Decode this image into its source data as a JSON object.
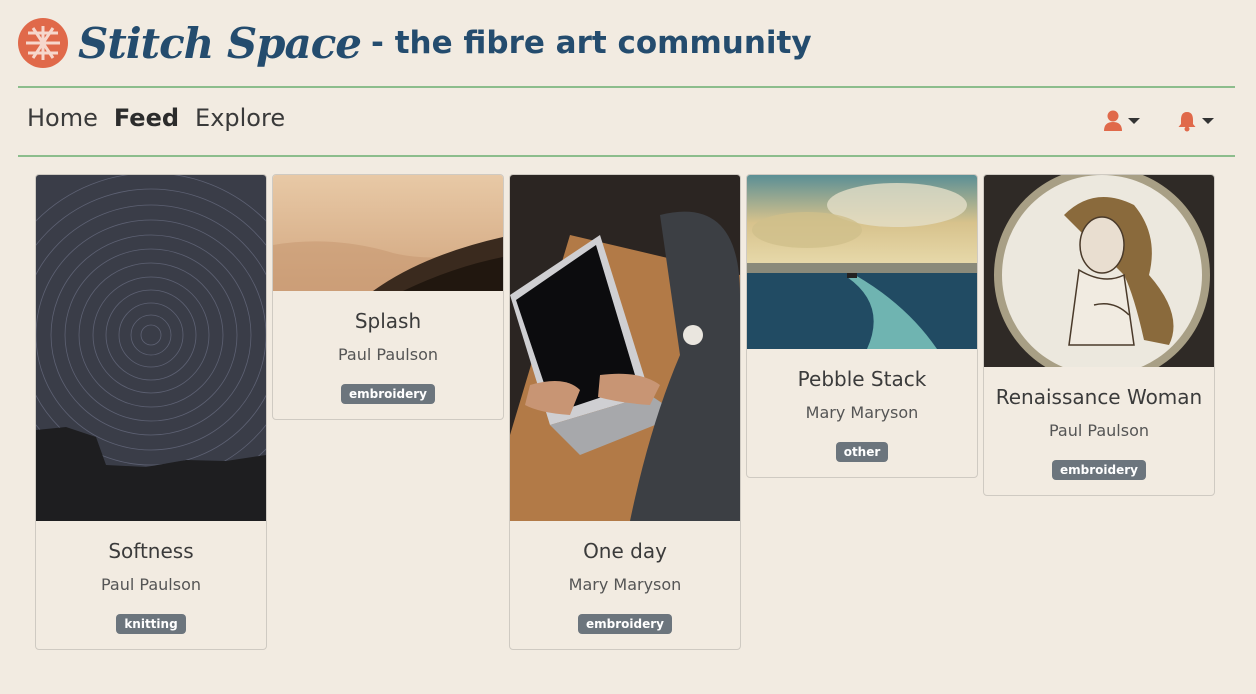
{
  "header": {
    "brand": "Stitch Space",
    "tagline": "- the fibre art community"
  },
  "nav": {
    "items": [
      {
        "label": "Home",
        "active": false
      },
      {
        "label": "Feed",
        "active": true
      },
      {
        "label": "Explore",
        "active": false
      }
    ],
    "user_icon": "user-icon",
    "bell_icon": "bell-icon"
  },
  "colors": {
    "background": "#f2ebe1",
    "brand": "#244c6e",
    "accent": "#e0694a",
    "rule": "#8cbd8c",
    "badge": "#6c757d"
  },
  "cards": [
    {
      "title": "Softness",
      "author": "Paul Paulson",
      "tag": "knitting",
      "image": "star-trails-night-sky"
    },
    {
      "title": "Splash",
      "author": "Paul Paulson",
      "tag": "embroidery",
      "image": "misty-hills"
    },
    {
      "title": "One day",
      "author": "Mary Maryson",
      "tag": "embroidery",
      "image": "laptop-typing"
    },
    {
      "title": "Pebble Stack",
      "author": "Mary Maryson",
      "tag": "other",
      "image": "boat-wake-sea"
    },
    {
      "title": "Renaissance Woman",
      "author": "Paul Paulson",
      "tag": "embroidery",
      "image": "embroidery-hoop-venus"
    }
  ]
}
